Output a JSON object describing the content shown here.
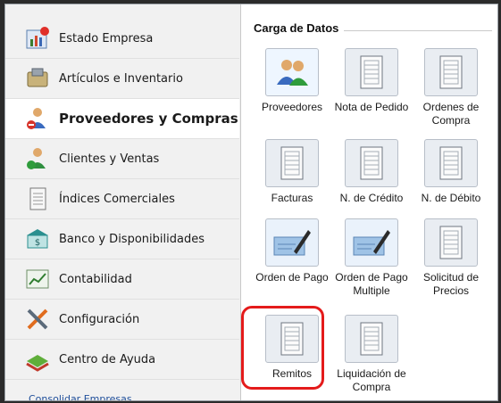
{
  "sidebar": {
    "items": [
      {
        "label": "Estado Empresa",
        "icon": "chart-icon",
        "active": false
      },
      {
        "label": "Artículos e Inventario",
        "icon": "inventory-icon",
        "active": false
      },
      {
        "label": "Proveedores y Compras",
        "icon": "suppliers-icon",
        "active": true
      },
      {
        "label": "Clientes y Ventas",
        "icon": "clients-icon",
        "active": false
      },
      {
        "label": "Índices Comerciales",
        "icon": "document-icon",
        "active": false
      },
      {
        "label": "Banco y Disponibilidades",
        "icon": "bank-icon",
        "active": false
      },
      {
        "label": "Contabilidad",
        "icon": "graph-icon",
        "active": false
      },
      {
        "label": "Configuración",
        "icon": "tools-icon",
        "active": false
      },
      {
        "label": "Centro de Ayuda",
        "icon": "book-icon",
        "active": false
      }
    ],
    "more_label": "Consolidar Empresas"
  },
  "panel": {
    "title": "Carga de Datos",
    "tiles": [
      {
        "label": "Proveedores",
        "icon": "people-icon"
      },
      {
        "label": "Nota de Pedido",
        "icon": "form-icon"
      },
      {
        "label": "Ordenes de Compra",
        "icon": "form-icon"
      },
      {
        "label": "Facturas",
        "icon": "form-icon"
      },
      {
        "label": "N. de Crédito",
        "icon": "form-icon"
      },
      {
        "label": "N. de Débito",
        "icon": "form-icon"
      },
      {
        "label": "Orden de Pago",
        "icon": "pen-check-icon"
      },
      {
        "label": "Orden de Pago Multiple",
        "icon": "pen-check-icon"
      },
      {
        "label": "Solicitud de Precios",
        "icon": "form-icon"
      },
      {
        "label": "Remitos",
        "icon": "form-icon"
      },
      {
        "label": "Liquidación de Compra",
        "icon": "form-icon"
      }
    ]
  },
  "colors": {
    "highlight": "#e41b1b",
    "link": "#1f4e9a"
  }
}
